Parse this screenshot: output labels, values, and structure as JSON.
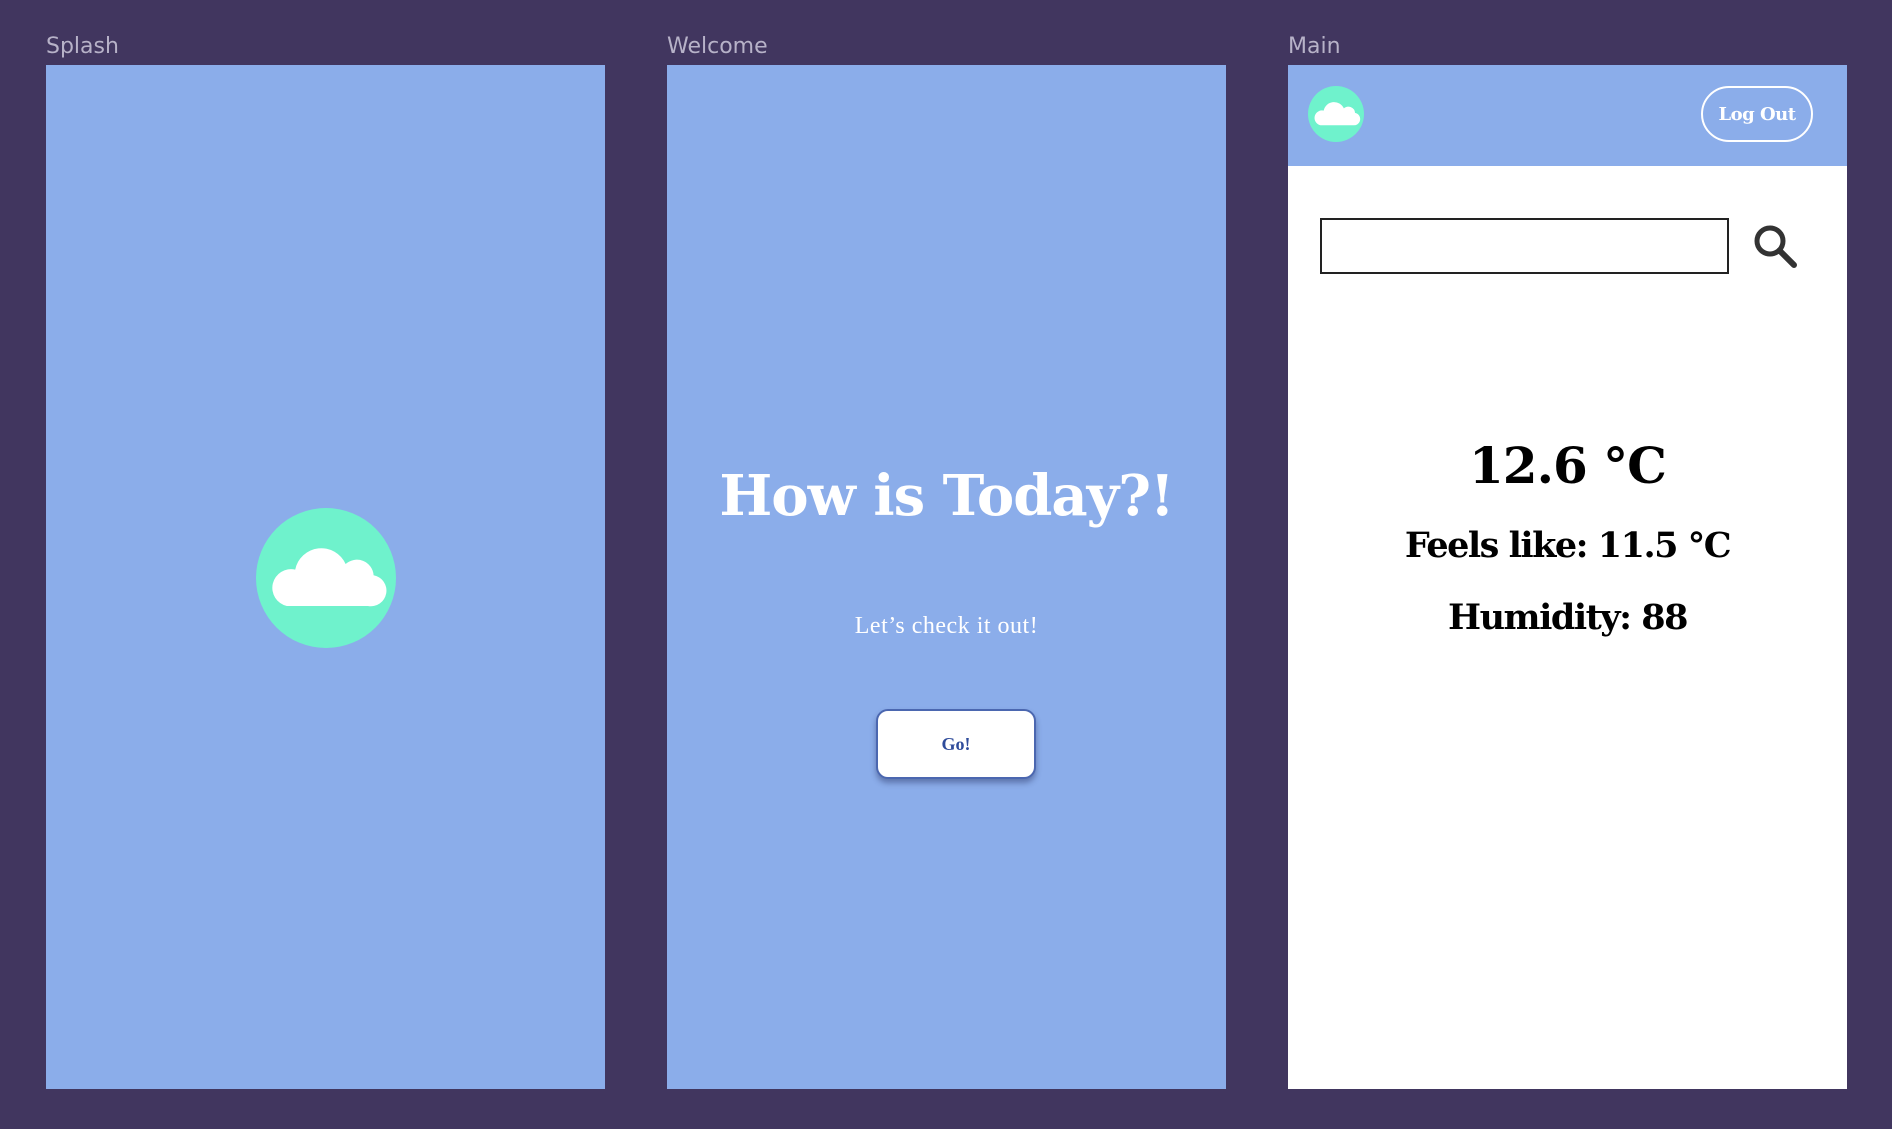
{
  "canvas": {
    "background_color": "#41365f"
  },
  "frames": {
    "splash": {
      "label": "Splash",
      "background_color": "#8badea",
      "logo_icon": "cloud-icon"
    },
    "welcome": {
      "label": "Welcome",
      "background_color": "#8badea",
      "title": "How is Today?!",
      "subtitle": "Let’s check it out!",
      "go_button_label": "Go!"
    },
    "main": {
      "label": "Main",
      "header_color": "#8badea",
      "logo_icon": "cloud-icon",
      "logout_label": "Log Out",
      "search": {
        "value": "",
        "placeholder": "",
        "icon": "search-icon"
      },
      "temperature": "12.6 °C",
      "feels_like": "Feels like: 11.5 °C",
      "humidity": "Humidity: 88"
    }
  },
  "colors": {
    "logo_circle": "#6ff2cc",
    "cloud": "#ffffff",
    "button_text": "#2f4c9b",
    "button_border": "#4b67b0"
  }
}
